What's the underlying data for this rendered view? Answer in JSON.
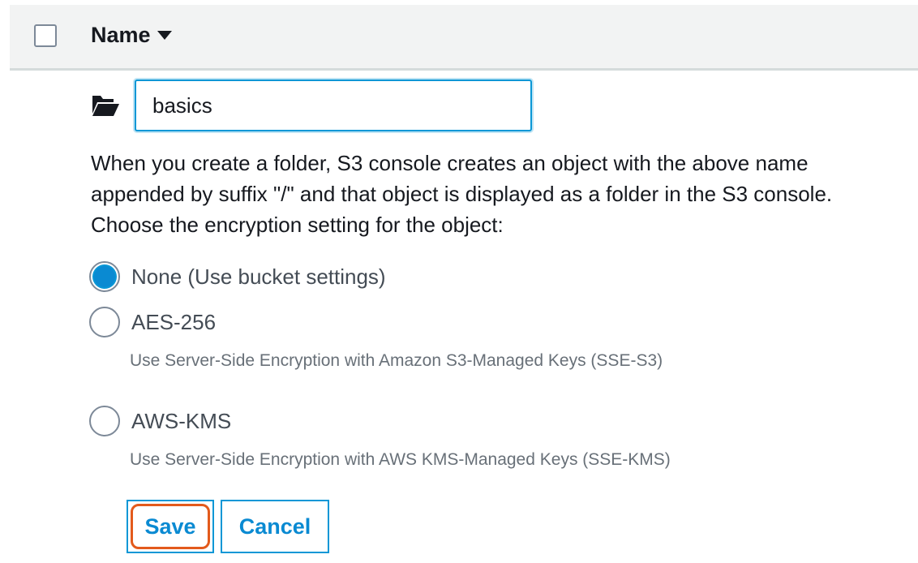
{
  "header": {
    "column_label": "Name"
  },
  "folder": {
    "input_value": "basics",
    "icon": "folder-open-icon"
  },
  "description": "When you create a folder, S3 console creates an object with the above name appended by suffix \"/\" and that object is displayed as a folder in the S3 console. Choose the encryption setting for the object:",
  "encryption_options": [
    {
      "label": "None (Use bucket settings)",
      "hint": "",
      "selected": true
    },
    {
      "label": "AES-256",
      "hint": "Use Server-Side Encryption with Amazon S3-Managed Keys (SSE-S3)",
      "selected": false
    },
    {
      "label": "AWS-KMS",
      "hint": "Use Server-Side Encryption with AWS KMS-Managed Keys (SSE-KMS)",
      "selected": false
    }
  ],
  "buttons": {
    "save_label": "Save",
    "cancel_label": "Cancel"
  },
  "colors": {
    "accent": "#0a8ad2",
    "highlight": "#e35a1c"
  }
}
